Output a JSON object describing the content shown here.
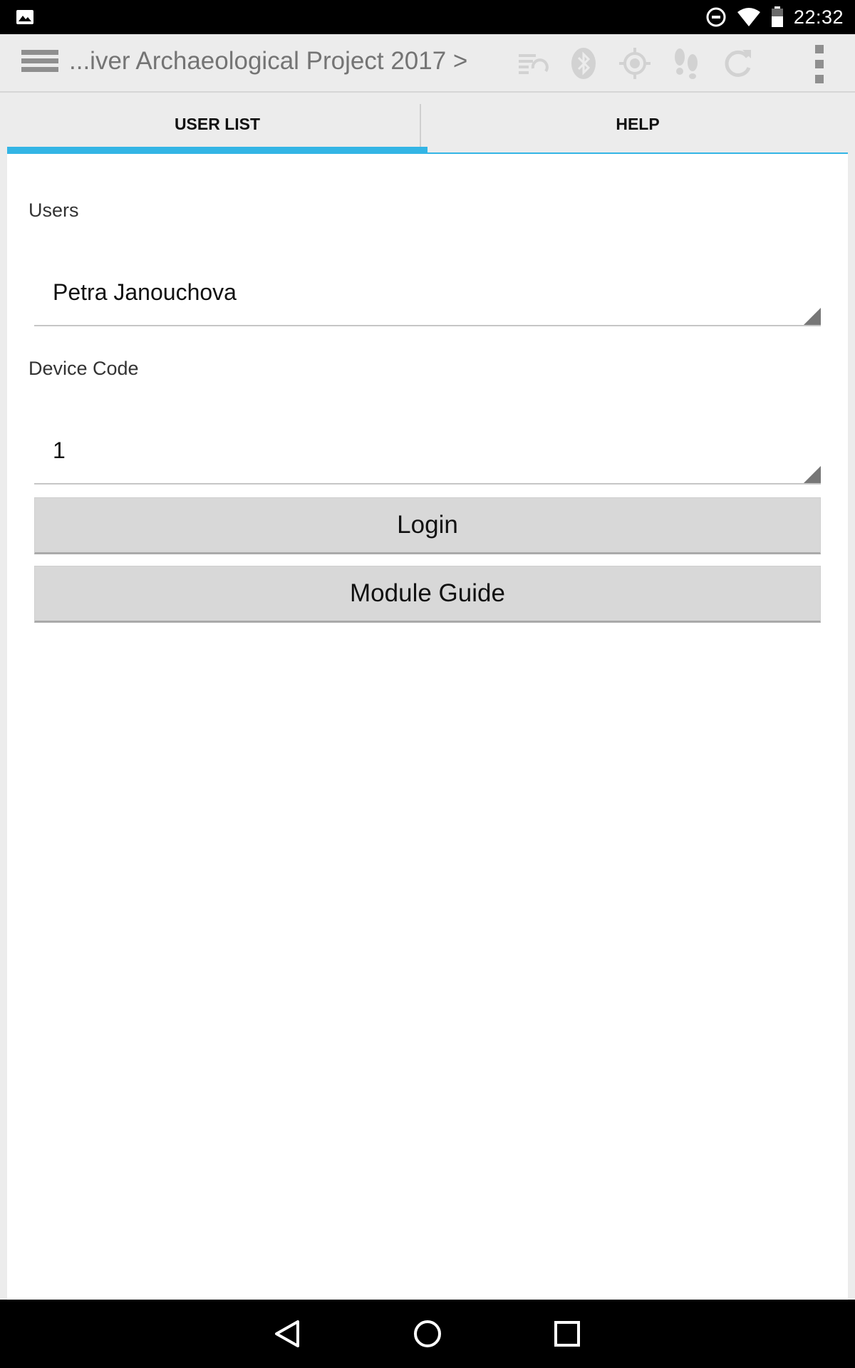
{
  "status_bar": {
    "time": "22:32",
    "icons": [
      "image-notification-icon",
      "do-not-disturb-icon",
      "wifi-icon",
      "battery-icon"
    ]
  },
  "action_bar": {
    "title": "...iver Archaeological Project 2017 >",
    "icons": [
      "sync-list-icon",
      "bluetooth-icon",
      "gps-icon",
      "footsteps-icon",
      "refresh-icon",
      "overflow-menu-icon"
    ],
    "icon_color": "#bdbdbd"
  },
  "tabs": [
    {
      "label": "USER LIST",
      "active": true
    },
    {
      "label": "HELP",
      "active": false
    }
  ],
  "form": {
    "users_label": "Users",
    "users_value": "Petra Janouchova",
    "device_code_label": "Device Code",
    "device_code_value": "1",
    "login_label": "Login",
    "module_guide_label": "Module Guide"
  },
  "nav_bar": {
    "icons": [
      "back-icon",
      "home-icon",
      "recents-icon"
    ]
  },
  "colors": {
    "accent": "#33b5e5",
    "background": "#ececec",
    "content": "#ffffff",
    "button": "#d8d8d8"
  }
}
